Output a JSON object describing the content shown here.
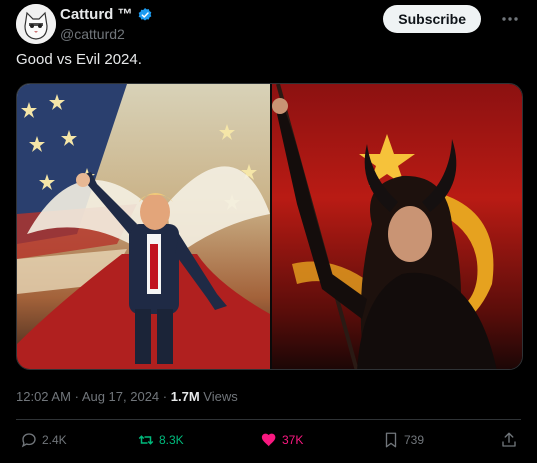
{
  "header": {
    "display_name": "Catturd ™",
    "handle": "@catturd2",
    "subscribe_label": "Subscribe",
    "verified_color": "#1d9bf0",
    "more_icon": "more-horizontal-icon"
  },
  "tweet": {
    "text": "Good vs Evil 2024."
  },
  "meta": {
    "time": "12:02 AM",
    "separator": "·",
    "date": "Aug 17, 2024",
    "views_count": "1.7M",
    "views_label": "Views"
  },
  "actions": {
    "replies": "2.4K",
    "retweets": "8.3K",
    "likes": "37K",
    "bookmarks": "739"
  },
  "colors": {
    "retweet": "#00ba7c",
    "like": "#f91880",
    "muted": "#71767b"
  }
}
